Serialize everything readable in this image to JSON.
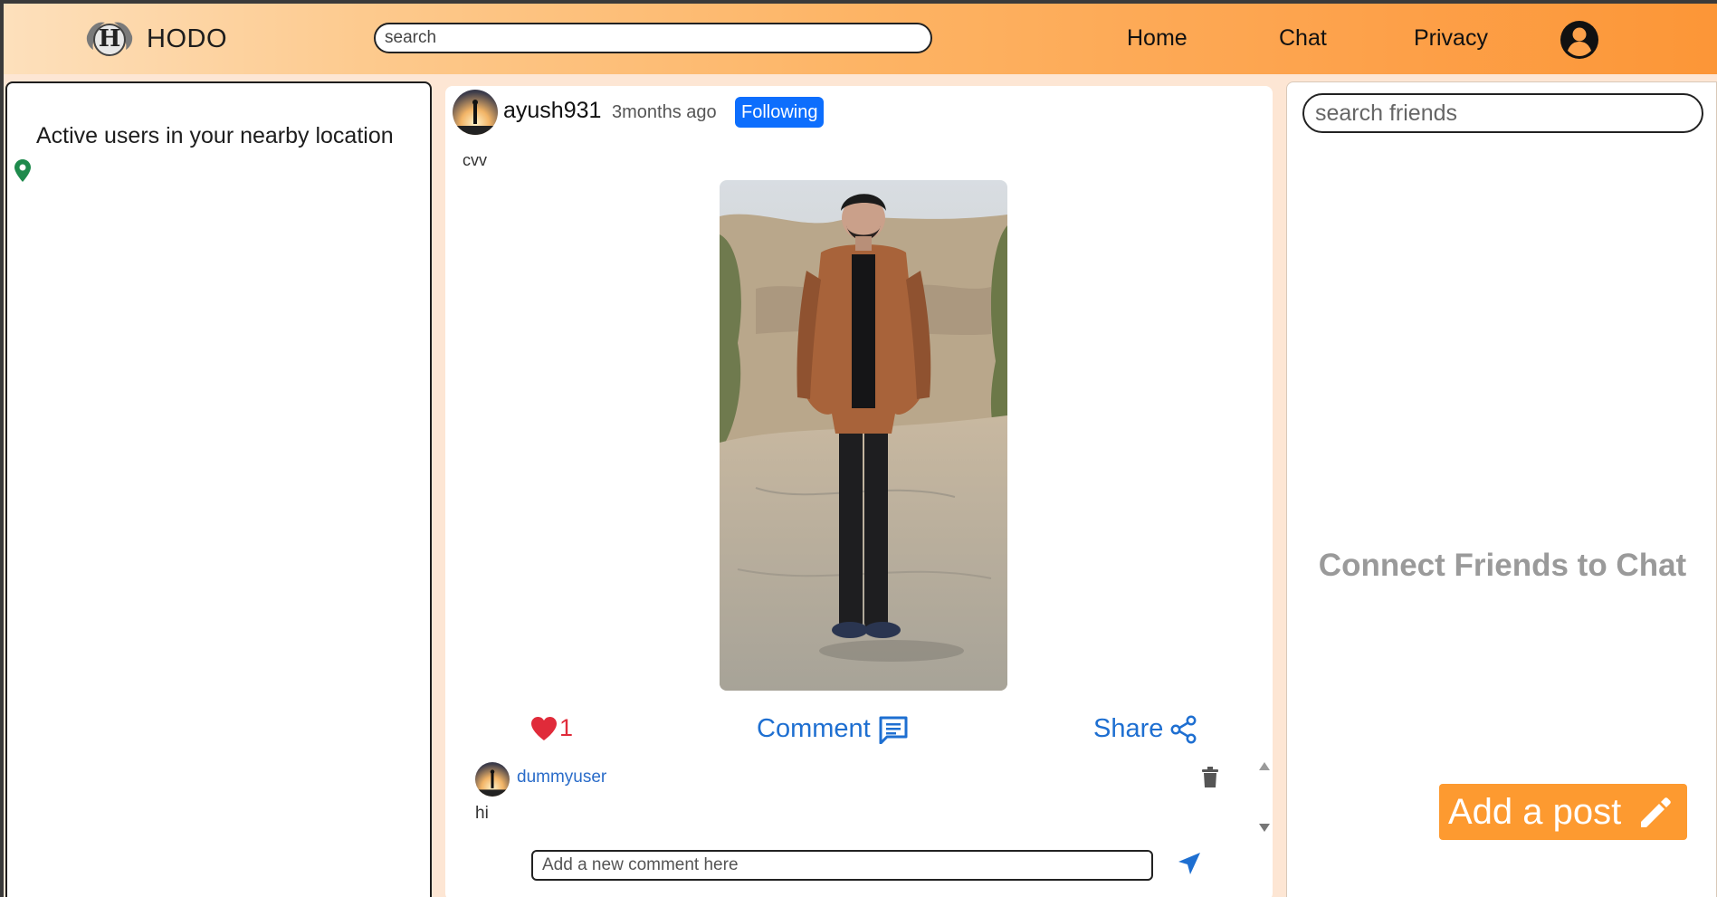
{
  "header": {
    "brand_name": "HODO",
    "logo_letter": "H",
    "search_placeholder": "search",
    "nav": {
      "home": "Home",
      "chat": "Chat",
      "privacy": "Privacy"
    },
    "profile_icon": "user-circle-icon"
  },
  "left_panel": {
    "title": "Active users in your nearby location",
    "location_icon": "map-pin-icon"
  },
  "post": {
    "username": "ayush931",
    "time_ago": "3months ago",
    "follow_status": "Following",
    "caption": "cvv",
    "like_count": "1",
    "comment_label": "Comment",
    "share_label": "Share",
    "comments": [
      {
        "username": "dummyuser",
        "text": "hi"
      }
    ],
    "comment_placeholder": "Add a new comment here"
  },
  "right_panel": {
    "search_placeholder": "search friends",
    "empty_message": "Connect Friends to Chat"
  },
  "add_post_label": "Add a post",
  "colors": {
    "accent_orange": "#fd9a30",
    "link_blue": "#1e6fd1",
    "badge_blue": "#0d6efd",
    "like_red": "#e02b3a",
    "pin_green": "#1e8a4c"
  }
}
